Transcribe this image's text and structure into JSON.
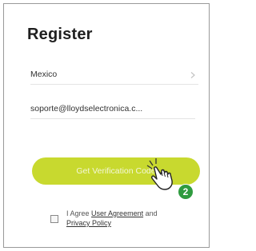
{
  "page": {
    "title": "Register"
  },
  "form": {
    "country": {
      "value": "Mexico",
      "icon": "chevron-right-icon"
    },
    "email": {
      "value": "soporte@lloydselectronica.c..."
    },
    "submit_label": "Get Verification Code"
  },
  "agreement": {
    "prefix": "I Agree",
    "user_agreement_link": "User Agreement",
    "conjunction": "and",
    "privacy_link": "Privacy Policy"
  },
  "annotation": {
    "step_number": "2",
    "pointer_icon": "pointing-hand-icon"
  },
  "colors": {
    "accent": "#c8d92f",
    "badge": "#2f9b3f"
  }
}
